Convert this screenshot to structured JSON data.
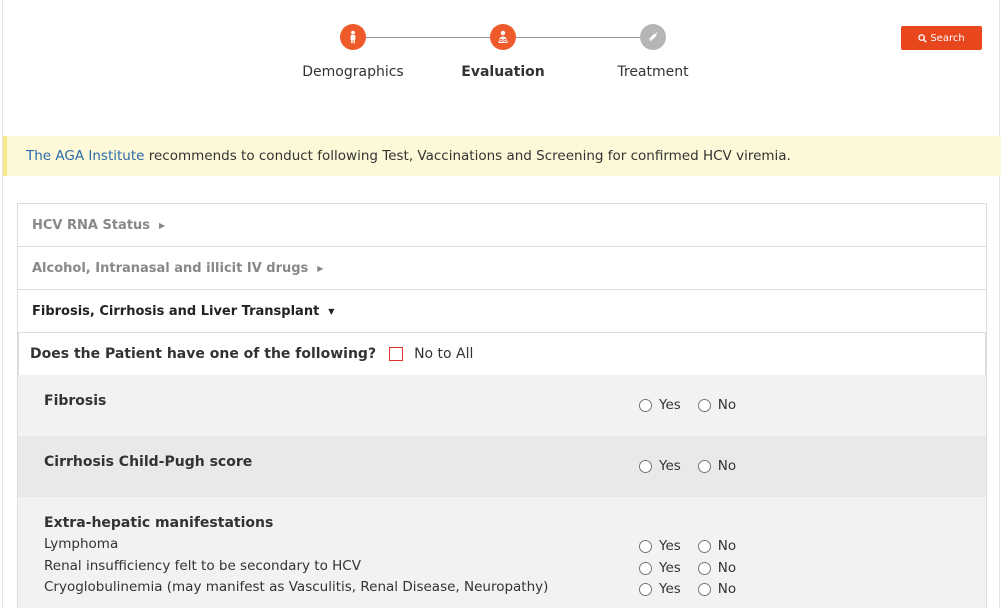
{
  "stepper": {
    "steps": [
      {
        "label": "Demographics",
        "state": "done",
        "icon": "person-icon"
      },
      {
        "label": "Evaluation",
        "state": "current",
        "icon": "doctor-icon"
      },
      {
        "label": "Treatment",
        "state": "pending",
        "icon": "syringe-icon"
      }
    ]
  },
  "search_button": {
    "label": "Search",
    "icon": "search-icon"
  },
  "banner": {
    "link_text": "The AGA Institute",
    "text": " recommends to conduct following Test, Vaccinations and Screening for confirmed HCV viremia."
  },
  "accordion": {
    "sections": [
      {
        "title": "HCV RNA Status",
        "expanded": false
      },
      {
        "title": "Alcohol, Intranasal and illicit IV drugs",
        "expanded": false
      },
      {
        "title": "Fibrosis, Cirrhosis and Liver Transplant",
        "expanded": true
      }
    ],
    "question": "Does the Patient have one of the following?",
    "no_to_all_label": "No to All",
    "yes_label": "Yes",
    "no_label": "No",
    "items": [
      {
        "title": "Fibrosis"
      },
      {
        "title": "Cirrhosis Child-Pugh score"
      },
      {
        "title": "Extra-hepatic manifestations",
        "subitems": [
          "Lymphoma",
          "Renal insufficiency felt to be secondary to HCV",
          "Cryoglobulinemia (may manifest as Vasculitis, Renal Disease, Neuropathy)"
        ]
      }
    ]
  },
  "colors": {
    "accent": "#ee5a2a",
    "search_bg": "#e8461d",
    "banner_bg": "#fdf8d8",
    "link": "#2a6ca8"
  }
}
